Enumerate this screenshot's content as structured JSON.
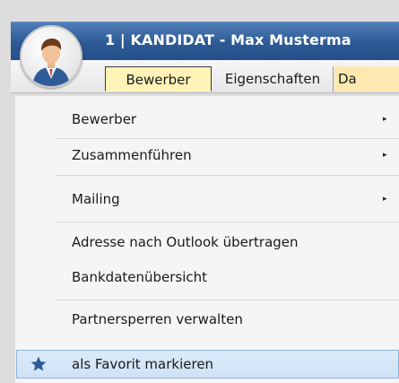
{
  "window": {
    "title": "1 | KANDIDAT - Max Musterma"
  },
  "tabs": [
    {
      "label": "Bewerber"
    },
    {
      "label": "Eigenschaften"
    },
    {
      "label": "Da"
    }
  ],
  "menu": {
    "items": [
      {
        "label": "Bewerber",
        "submenu": true
      },
      {
        "label": "Zusammenführen",
        "submenu": true
      },
      {
        "label": "Mailing",
        "submenu": true
      },
      {
        "label": "Adresse nach Outlook übertragen",
        "submenu": false
      },
      {
        "label": "Bankdatenübersicht",
        "submenu": false
      },
      {
        "label": "Partnersperren verwalten",
        "submenu": false
      },
      {
        "label": "als Favorit markieren",
        "submenu": false,
        "icon": "star-icon",
        "highlighted": true
      }
    ],
    "arrow_glyph": "▸"
  },
  "colors": {
    "titlebar": "#2d5a94",
    "active_tab": "#fff3b8",
    "highlight": "#cfe2f6",
    "star": "#2c5c9a"
  }
}
